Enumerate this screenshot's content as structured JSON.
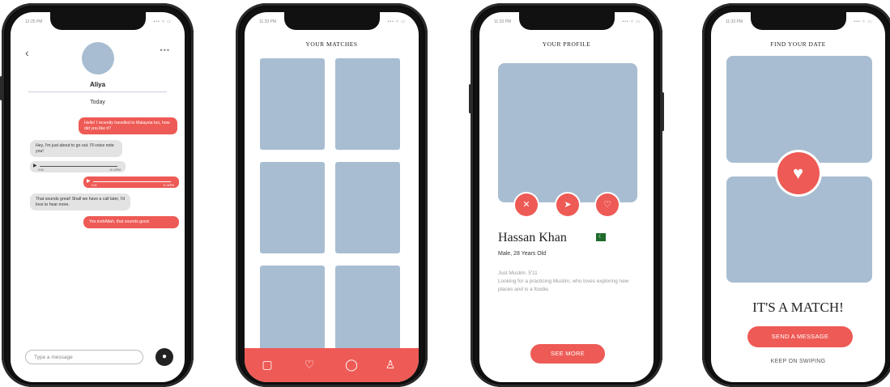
{
  "status_bar": {
    "time": "12:25 PM",
    "time_alt": "11:33 PM",
    "icons": "••• ≈ ▭"
  },
  "chat": {
    "contact_name": "Aliya",
    "day_label": "Today",
    "messages": [
      {
        "from": "me",
        "text": "Hello! I recently travelled to Malaysia too, how did you like it?"
      },
      {
        "from": "them",
        "text": "Hey, I'm just about to go out. I'll voice note you!"
      },
      {
        "from": "them",
        "type": "voice",
        "start": "0:00",
        "end": "11:19PM"
      },
      {
        "from": "me",
        "type": "voice",
        "start": "0:41",
        "end": "11:26PM"
      },
      {
        "from": "them",
        "text": "That sounds great! Shall we have a call later, I'd love to hear more."
      },
      {
        "from": "me",
        "text": "Yes inshAllah, that sounds good."
      }
    ],
    "input_placeholder": "Type a message",
    "icons": {
      "back": "chevron-left-icon",
      "more": "ellipsis-icon",
      "mic": "microphone-icon"
    }
  },
  "matches": {
    "title": "YOUR MATCHES",
    "tabs": [
      "cards-icon",
      "heart-icon",
      "chat-bubble-icon",
      "person-icon"
    ]
  },
  "profile": {
    "title": "YOUR PROFILE",
    "name": "Hassan Khan",
    "details": "Male, 28 Years Old",
    "tagline": "Just Muslim. 5'11",
    "bio": "Looking for a practicing Muslim, who loves exploring new places and is a foodie.",
    "see_more": "SEE MORE",
    "actions": [
      "close-icon",
      "send-icon",
      "heart-icon"
    ],
    "flag": "pakistan-flag-icon"
  },
  "match_screen": {
    "title": "FIND YOUR DATE",
    "headline": "IT'S A MATCH!",
    "send_message": "SEND A MESSAGE",
    "keep_swiping": "KEEP ON SWIPING"
  },
  "colors": {
    "accent": "#ee5a55",
    "placeholder_photo": "#a8bdd1",
    "frame": "#111111"
  }
}
